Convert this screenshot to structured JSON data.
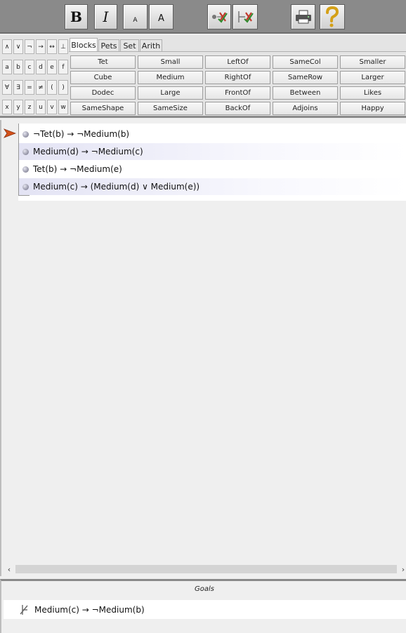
{
  "toolbar": {
    "bold": "B",
    "italic": "I",
    "font_small": "A",
    "font_large": "A",
    "icons": [
      "verify-proof-icon",
      "add-goal-icon",
      "print-icon",
      "help-icon"
    ]
  },
  "symbols": [
    [
      "∧",
      "∨",
      "¬",
      "→",
      "↔",
      "⊥"
    ],
    [
      "a",
      "b",
      "c",
      "d",
      "e",
      "f"
    ],
    [
      "∀",
      "∃",
      "=",
      "≠",
      "(",
      ")"
    ],
    [
      "x",
      "y",
      "z",
      "u",
      "v",
      "w"
    ]
  ],
  "tabs": [
    "Blocks",
    "Pets",
    "Set",
    "Arith"
  ],
  "active_tab": "Blocks",
  "predicates": [
    [
      "Tet",
      "Small",
      "LeftOf",
      "SameCol",
      "Smaller"
    ],
    [
      "Cube",
      "Medium",
      "RightOf",
      "SameRow",
      "Larger"
    ],
    [
      "Dodec",
      "Large",
      "FrontOf",
      "Between",
      "Likes"
    ],
    [
      "SameShape",
      "SameSize",
      "BackOf",
      "Adjoins",
      "Happy"
    ]
  ],
  "premises": [
    "¬Tet(b) → ¬Medium(b)",
    "Medium(d) → ¬Medium(c)",
    "Tet(b) → ¬Medium(e)",
    "Medium(c) → (Medium(d) ∨ Medium(e))"
  ],
  "scroll": {
    "left": "‹",
    "right": "›"
  },
  "goals": {
    "title": "Goals",
    "items": [
      "Medium(c) → ¬Medium(b)"
    ]
  }
}
